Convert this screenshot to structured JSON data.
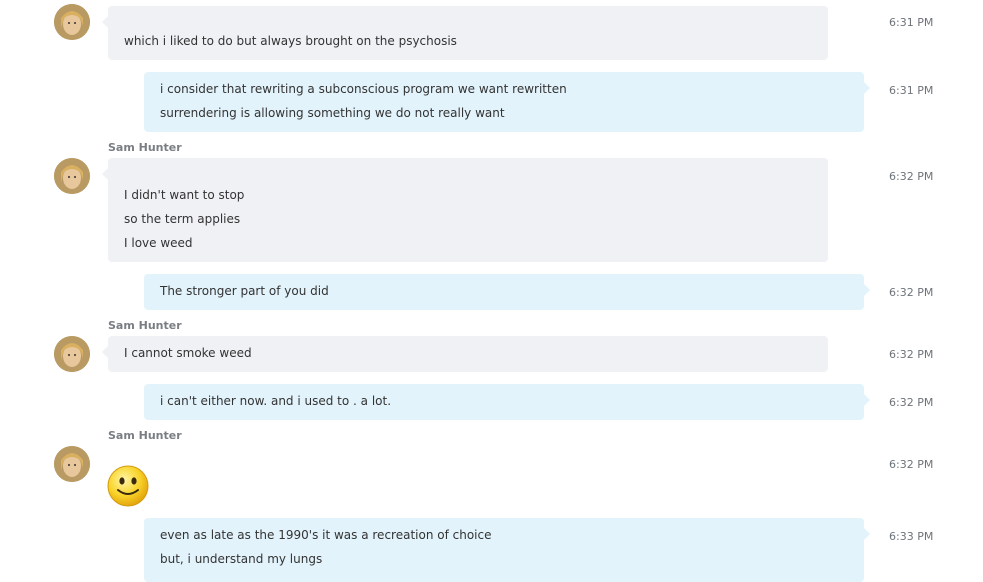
{
  "messages": [
    {
      "kind": "in",
      "lines": [
        "which i liked to do but always brought on the psychosis"
      ],
      "time": "6:31 PM"
    },
    {
      "kind": "out",
      "lines": [
        "i consider that rewriting a subconscious program we want rewritten",
        "surrendering is allowing something we do not really want"
      ],
      "time": "6:31 PM"
    },
    {
      "kind": "in",
      "sender": "Sam Hunter",
      "lines": [
        "I didn't want to stop",
        "so the term applies",
        "I love weed"
      ],
      "time": "6:32 PM"
    },
    {
      "kind": "out",
      "lines": [
        "The stronger part of you did"
      ],
      "time": "6:32 PM"
    },
    {
      "kind": "in",
      "sender": "Sam Hunter",
      "lines": [
        "I cannot smoke weed"
      ],
      "time": "6:32 PM"
    },
    {
      "kind": "out",
      "lines": [
        "i can't either now.  and i used to .  a lot."
      ],
      "time": "6:32 PM"
    },
    {
      "kind": "in",
      "sender": "Sam Hunter",
      "emoticon": "smile-emoticon-icon",
      "time": "6:32 PM"
    },
    {
      "kind": "out",
      "lines": [
        "even as late as the 1990's it was a recreation of choice",
        "but, i understand my lungs"
      ],
      "time": "6:33 PM"
    }
  ],
  "avatar_icon": "contact-avatar-icon",
  "colors": {
    "incoming_bubble": "#eff1f5",
    "outgoing_bubble": "#e2f3fb",
    "timestamp": "#6e7379",
    "sender": "#7a7e84"
  }
}
